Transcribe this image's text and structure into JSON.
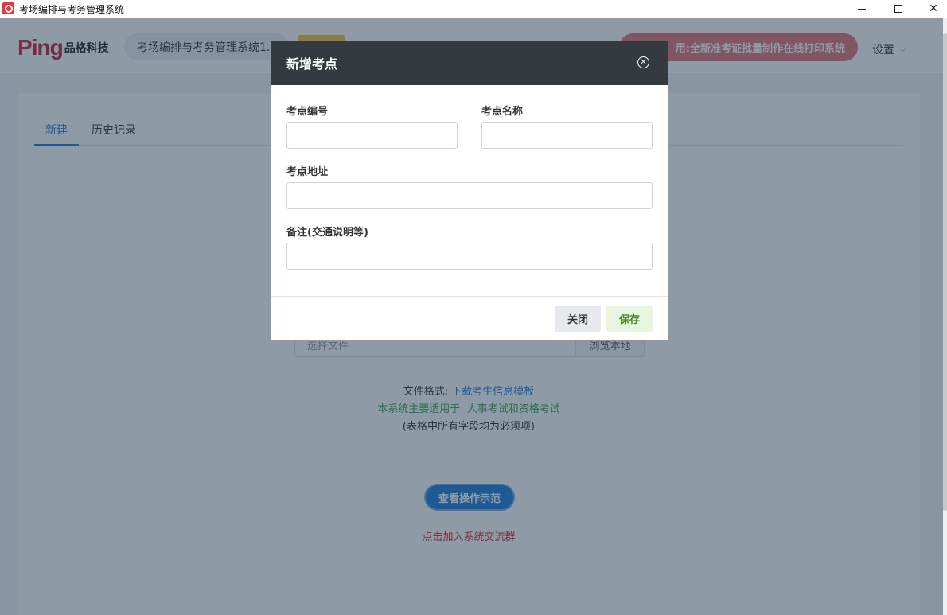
{
  "window": {
    "title": "考场编排与考务管理系统",
    "icon": "app-icon",
    "controls": {
      "minimize": "minimize-icon",
      "maximize": "maximize-icon",
      "close": "✕"
    }
  },
  "header": {
    "logo_brand": "Ping",
    "logo_company": "品格科技",
    "system_name": "考场编排与考务管理系统1.1",
    "promo_text": "用:全新准考证批量制作在线打印系统",
    "settings_label": "设置",
    "settings_chevron": "⌵"
  },
  "tabs": [
    {
      "label": "新建",
      "active": true
    },
    {
      "label": "历史记录",
      "active": false
    }
  ],
  "upload": {
    "placeholder": "选择文件",
    "browse_label": "浏览本地"
  },
  "info": {
    "format_prefix": "文件格式:",
    "template_link": "下载考生信息模板",
    "scope_text": "本系统主要适用于: 人事考试和资格考试",
    "required_note": "(表格中所有字段均为必须项)"
  },
  "demo_button": "查看操作示范",
  "join_group_link": "点击加入系统交流群",
  "modal": {
    "title": "新增考点",
    "close_icon": "✕",
    "fields": {
      "code_label": "考点编号",
      "code_value": "",
      "name_label": "考点名称",
      "name_value": "",
      "address_label": "考点地址",
      "address_value": "",
      "note_label": "备注(交通说明等)",
      "note_value": ""
    },
    "close_button": "关闭",
    "save_button": "保存"
  },
  "colors": {
    "brand_red": "#d6283b",
    "primary_blue": "#1e7ad8",
    "modal_header": "#343a40",
    "overlay": "rgba(30,55,80,0.5)",
    "scope_green": "#3fa14a",
    "join_red": "#d8272b"
  }
}
